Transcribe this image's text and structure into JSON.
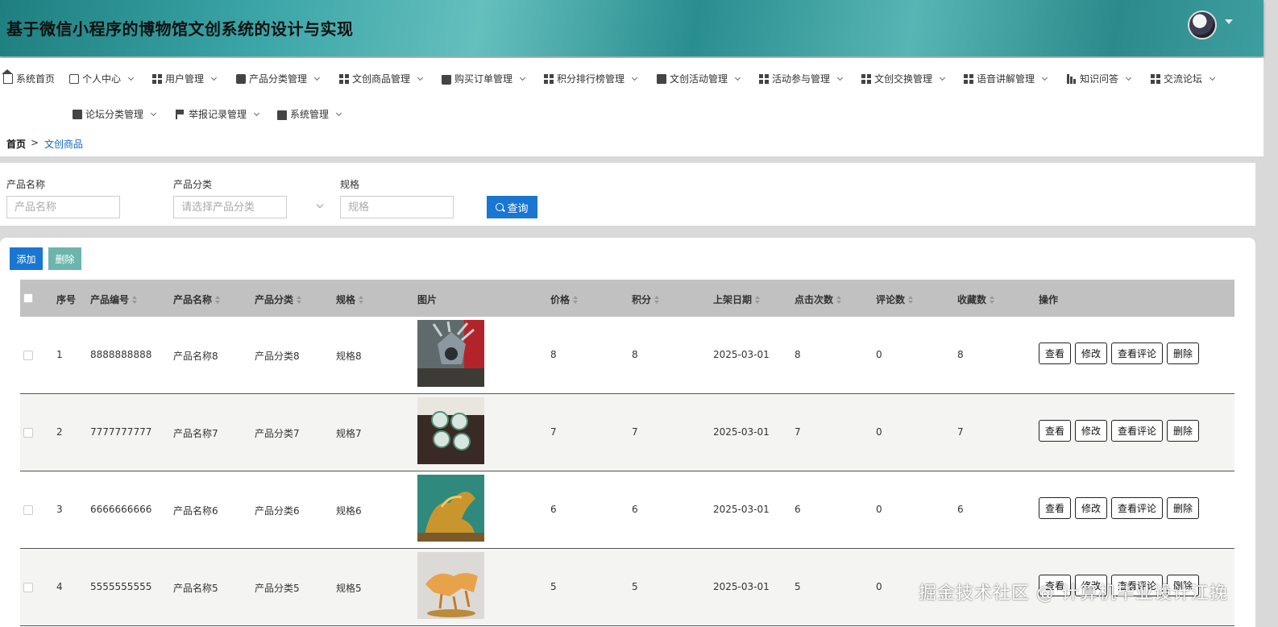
{
  "header": {
    "title": "基于微信小程序的博物馆文创系统的设计与实现"
  },
  "nav": [
    {
      "label": "系统首页",
      "icon": "home-icon"
    },
    {
      "label": "个人中心",
      "icon": "card-icon"
    },
    {
      "label": "用户管理",
      "icon": "grid-icon"
    },
    {
      "label": "产品分类管理",
      "icon": "chat-icon"
    },
    {
      "label": "文创商品管理",
      "icon": "grid-icon"
    },
    {
      "label": "购买订单管理",
      "icon": "bag-icon"
    },
    {
      "label": "积分排行榜管理",
      "icon": "grid-icon"
    },
    {
      "label": "文创活动管理",
      "icon": "clipboard-icon"
    },
    {
      "label": "活动参与管理",
      "icon": "grid-icon"
    },
    {
      "label": "文创交换管理",
      "icon": "grid-icon"
    },
    {
      "label": "语音讲解管理",
      "icon": "grid-icon"
    },
    {
      "label": "知识问答",
      "icon": "bars-icon"
    },
    {
      "label": "交流论坛",
      "icon": "grid-icon"
    },
    {
      "label": "论坛分类管理",
      "icon": "monitor-icon"
    },
    {
      "label": "举报记录管理",
      "icon": "flag-icon"
    },
    {
      "label": "系统管理",
      "icon": "briefcase-icon"
    }
  ],
  "breadcrumb": {
    "home": "首页",
    "separator": ">",
    "current": "文创商品"
  },
  "search": {
    "name_label": "产品名称",
    "name_placeholder": "产品名称",
    "category_label": "产品分类",
    "category_placeholder": "请选择产品分类",
    "spec_label": "规格",
    "spec_placeholder": "规格",
    "query_label": "查询"
  },
  "actions": {
    "add": "添加",
    "delete": "删除"
  },
  "table": {
    "columns": [
      "序号",
      "产品编号",
      "产品名称",
      "产品分类",
      "规格",
      "图片",
      "价格",
      "积分",
      "上架日期",
      "点击次数",
      "评论数",
      "收藏数",
      "操作"
    ],
    "ops": [
      "查看",
      "修改",
      "查看评论",
      "删除"
    ],
    "rows": [
      {
        "idx": "1",
        "code": "8888888888",
        "name": "产品名称8",
        "category": "产品分类8",
        "spec": "规格8",
        "price": "8",
        "points": "8",
        "date": "2025-03-01",
        "clicks": "8",
        "comments": "0",
        "favorites": "8"
      },
      {
        "idx": "2",
        "code": "7777777777",
        "name": "产品名称7",
        "category": "产品分类7",
        "spec": "规格7",
        "price": "7",
        "points": "7",
        "date": "2025-03-01",
        "clicks": "7",
        "comments": "0",
        "favorites": "7"
      },
      {
        "idx": "3",
        "code": "6666666666",
        "name": "产品名称6",
        "category": "产品分类6",
        "spec": "规格6",
        "price": "6",
        "points": "6",
        "date": "2025-03-01",
        "clicks": "6",
        "comments": "0",
        "favorites": "6"
      },
      {
        "idx": "4",
        "code": "5555555555",
        "name": "产品名称5",
        "category": "产品分类5",
        "spec": "规格5",
        "price": "5",
        "points": "5",
        "date": "2025-03-01",
        "clicks": "5",
        "comments": "0",
        "favorites": ""
      }
    ]
  },
  "watermark": "掘金技术社区 @ 计算机毕业设计江挽",
  "colors": {
    "primary": "#1976d2",
    "delete_button": "#6bb5ae",
    "header_teal": "#2a8d8f",
    "table_header": "#c1c1c1"
  }
}
